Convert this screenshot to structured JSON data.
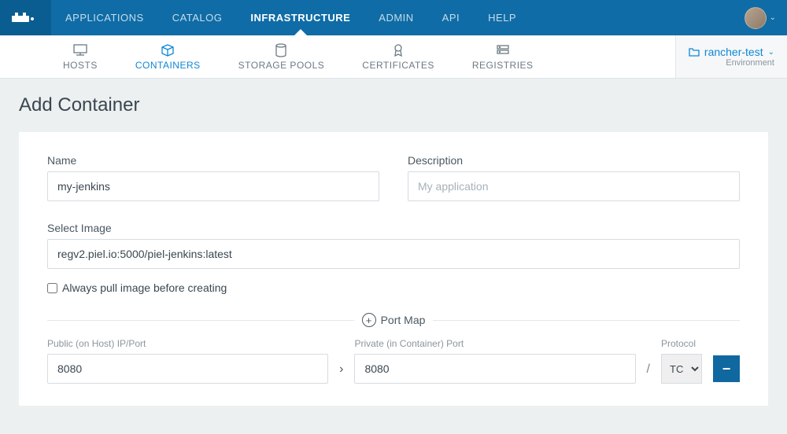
{
  "topnav": {
    "items": [
      {
        "label": "APPLICATIONS"
      },
      {
        "label": "CATALOG"
      },
      {
        "label": "INFRASTRUCTURE",
        "active": true
      },
      {
        "label": "ADMIN"
      },
      {
        "label": "API"
      },
      {
        "label": "HELP"
      }
    ]
  },
  "subnav": {
    "items": [
      {
        "label": "HOSTS"
      },
      {
        "label": "CONTAINERS",
        "active": true
      },
      {
        "label": "STORAGE POOLS"
      },
      {
        "label": "CERTIFICATES"
      },
      {
        "label": "REGISTRIES"
      }
    ]
  },
  "environment": {
    "name": "rancher-test",
    "label": "Environment"
  },
  "page": {
    "title": "Add Container"
  },
  "form": {
    "name_label": "Name",
    "name_value": "my-jenkins",
    "description_label": "Description",
    "description_placeholder": "My application",
    "image_label": "Select Image",
    "image_value": "regv2.piel.io:5000/piel-jenkins:latest",
    "pull_label": "Always pull image before creating"
  },
  "portmap": {
    "title": "Port Map",
    "public_label": "Public (on Host) IP/Port",
    "private_label": "Private (in Container) Port",
    "protocol_label": "Protocol",
    "public_value": "8080",
    "private_value": "8080",
    "protocol_value": "TCP"
  }
}
